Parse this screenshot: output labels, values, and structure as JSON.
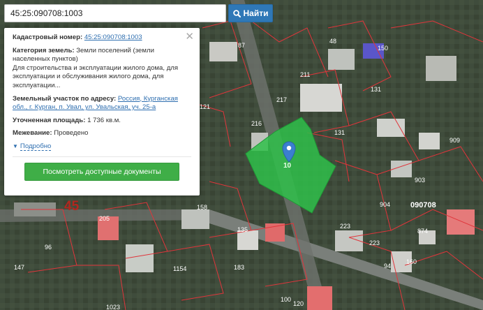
{
  "search": {
    "value": "45:25:090708:1003",
    "button_label": "Найти",
    "button_icon": "search-icon"
  },
  "info": {
    "cadastral_label": "Кадастровый номер:",
    "cadastral_value": "45:25:090708:1003",
    "category_label": "Категория земель:",
    "category_value": "Земли поселений (земли населенных пунктов)",
    "purpose": "Для строительства и эксплуатации жилого дома, для эксплуатации и обслуживания жилого дома, для эксплуатации...",
    "address_label": "Земельный участок по адресу:",
    "address_value": "Россия, Курганская обл., г. Курган, п. Увал, ул. Увальская, уч. 25-а",
    "area_label": "Уточненная площадь:",
    "area_value": "1 736 кв.м.",
    "survey_label": "Межевание:",
    "survey_value": "Проведено",
    "more_label": "Подробно",
    "docs_button": "Посмотреть доступные документы",
    "close_icon": "close-icon"
  },
  "map": {
    "zone_label": "45",
    "quarter_label": "090708",
    "parcel_marker_label": "10",
    "selected_color": "#2fbf4a",
    "boundary_color": "#e0353b",
    "parcel_numbers": [
      "48",
      "87",
      "150",
      "211",
      "131",
      "217",
      "121",
      "216",
      "131",
      "909",
      "903",
      "904",
      "874",
      "223",
      "223",
      "94",
      "160",
      "120",
      "100",
      "1023",
      "158",
      "135",
      "183",
      "1154",
      "147",
      "96",
      "205",
      "1023",
      "216"
    ]
  }
}
